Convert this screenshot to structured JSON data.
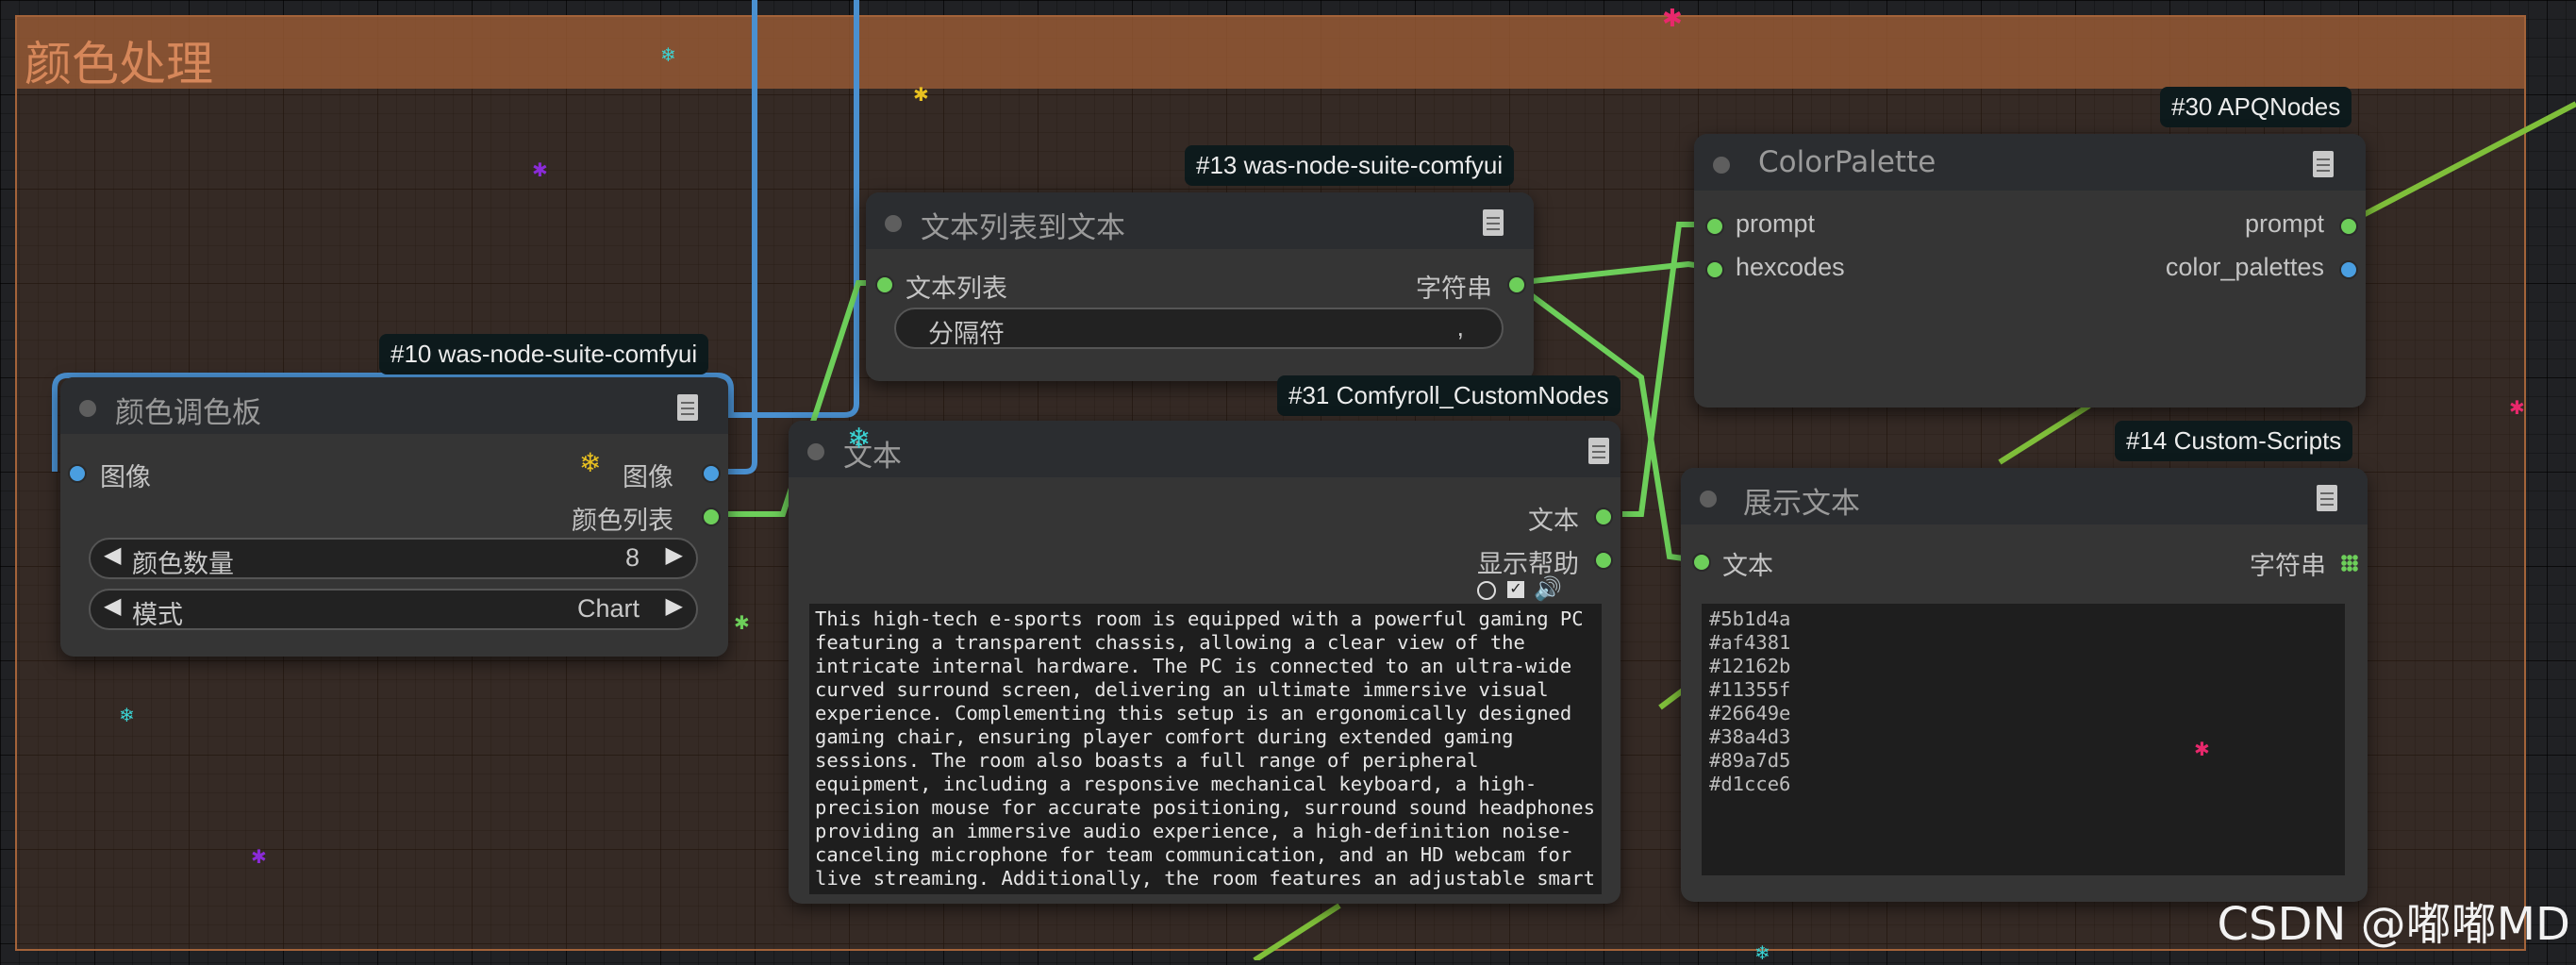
{
  "group": {
    "title": "颜色处理"
  },
  "nodes": {
    "palette": {
      "badge": "#10 was-node-suite-comfyui",
      "title": "颜色调色板",
      "inputs": [
        "图像"
      ],
      "outputs": [
        "图像",
        "颜色列表"
      ],
      "widgets": [
        {
          "label": "颜色数量",
          "value": "8"
        },
        {
          "label": "模式",
          "value": "Chart"
        }
      ]
    },
    "textlist": {
      "badge": "#13 was-node-suite-comfyui",
      "title": "文本列表到文本",
      "inputs": [
        "文本列表"
      ],
      "outputs": [
        "字符串"
      ],
      "widget": {
        "label": "分隔符",
        "value": ","
      }
    },
    "text": {
      "badge": "#31 Comfyroll_CustomNodes",
      "title": "文本",
      "outputs": [
        "文本",
        "显示帮助"
      ],
      "body": "This high-tech e-sports room is equipped with a powerful gaming PC\nfeaturing a transparent chassis, allowing a clear view of the\nintricate internal hardware. The PC is connected to an ultra-wide\ncurved surround screen, delivering an ultimate immersive visual\nexperience. Complementing this setup is an ergonomically designed\ngaming chair, ensuring player comfort during extended gaming\nsessions. The room also boasts a full range of peripheral\nequipment, including a responsive mechanical keyboard, a high-\nprecision mouse for accurate positioning, surround sound headphones\nproviding an immersive audio experience, a high-definition noise-\ncanceling microphone for team communication, and an HD webcam for\nlive streaming. Additionally, the room features an adjustable smart"
    },
    "colorpalette": {
      "badge": "#30 APQNodes",
      "title": "ColorPalette",
      "inputs": [
        "prompt",
        "hexcodes"
      ],
      "outputs": [
        "prompt",
        "color_palettes"
      ]
    },
    "showtext": {
      "badge": "#14 Custom-Scripts",
      "title": "展示文本",
      "inputs": [
        "文本"
      ],
      "outputs": [
        "字符串"
      ],
      "body": "#5b1d4a\n#af4381\n#12162b\n#11355f\n#26649e\n#38a4d3\n#89a7d5\n#d1cce6"
    }
  },
  "colors": {
    "wire_image": "#4a90d0",
    "wire_string": "#6dcf5a",
    "wire_prompt": "#7fbf3a",
    "group_header": "#a05f37"
  },
  "watermark": "CSDN @嘟嘟MD"
}
